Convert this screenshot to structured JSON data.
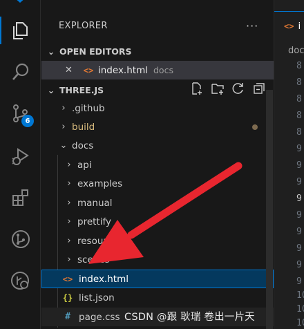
{
  "explorer": {
    "title": "EXPLORER",
    "more": "···",
    "open_editors_label": "OPEN EDITORS",
    "open_editor": {
      "close": "✕",
      "name": "index.html",
      "folder": "docs"
    },
    "project_label": "THREE.JS",
    "tree": [
      {
        "name": ".github",
        "chevron": "›"
      },
      {
        "name": "build",
        "chevron": "›"
      },
      {
        "name": "docs",
        "chevron": "⌄"
      },
      {
        "name": "api",
        "chevron": "›"
      },
      {
        "name": "examples",
        "chevron": "›"
      },
      {
        "name": "manual",
        "chevron": "›"
      },
      {
        "name": "prettify",
        "chevron": "›"
      },
      {
        "name": "resour",
        "chevron": "›"
      },
      {
        "name": "scenes",
        "chevron": "›"
      },
      {
        "name": "index.html",
        "icon": "<>"
      },
      {
        "name": "list.json",
        "icon": "{}"
      },
      {
        "name": "page.css",
        "icon": "#"
      }
    ]
  },
  "activity": {
    "scm_badge": "6"
  },
  "editor": {
    "tab_label": "i",
    "breadcrumb": "doc",
    "line_numbers": [
      "8",
      "8",
      "8",
      "8",
      "8",
      "9",
      "9",
      "9",
      "9",
      "9",
      "9",
      "9",
      "9",
      "9",
      "10",
      "10",
      "10"
    ]
  },
  "watermark": "CSDN @跟 耿瑞 卷出一片天",
  "colors": {
    "accent": "#0078d4",
    "arrow": "#e8262f",
    "selection": "#04395e"
  }
}
